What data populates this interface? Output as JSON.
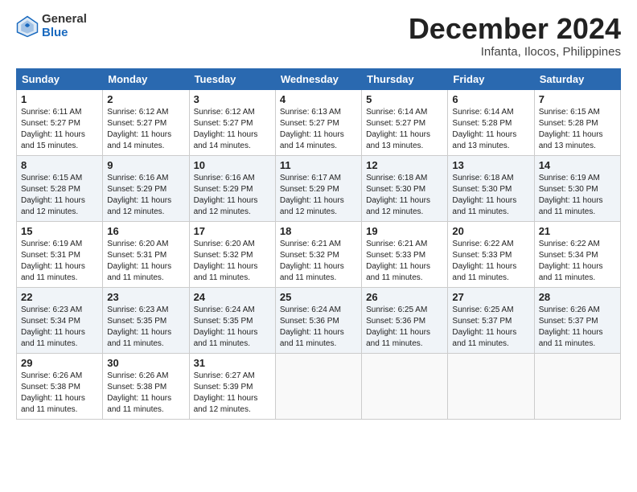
{
  "logo": {
    "general": "General",
    "blue": "Blue"
  },
  "header": {
    "month": "December 2024",
    "location": "Infanta, Ilocos, Philippines"
  },
  "weekdays": [
    "Sunday",
    "Monday",
    "Tuesday",
    "Wednesday",
    "Thursday",
    "Friday",
    "Saturday"
  ],
  "weeks": [
    [
      {
        "day": "1",
        "info": "Sunrise: 6:11 AM\nSunset: 5:27 PM\nDaylight: 11 hours\nand 15 minutes."
      },
      {
        "day": "2",
        "info": "Sunrise: 6:12 AM\nSunset: 5:27 PM\nDaylight: 11 hours\nand 14 minutes."
      },
      {
        "day": "3",
        "info": "Sunrise: 6:12 AM\nSunset: 5:27 PM\nDaylight: 11 hours\nand 14 minutes."
      },
      {
        "day": "4",
        "info": "Sunrise: 6:13 AM\nSunset: 5:27 PM\nDaylight: 11 hours\nand 14 minutes."
      },
      {
        "day": "5",
        "info": "Sunrise: 6:14 AM\nSunset: 5:27 PM\nDaylight: 11 hours\nand 13 minutes."
      },
      {
        "day": "6",
        "info": "Sunrise: 6:14 AM\nSunset: 5:28 PM\nDaylight: 11 hours\nand 13 minutes."
      },
      {
        "day": "7",
        "info": "Sunrise: 6:15 AM\nSunset: 5:28 PM\nDaylight: 11 hours\nand 13 minutes."
      }
    ],
    [
      {
        "day": "8",
        "info": "Sunrise: 6:15 AM\nSunset: 5:28 PM\nDaylight: 11 hours\nand 12 minutes."
      },
      {
        "day": "9",
        "info": "Sunrise: 6:16 AM\nSunset: 5:29 PM\nDaylight: 11 hours\nand 12 minutes."
      },
      {
        "day": "10",
        "info": "Sunrise: 6:16 AM\nSunset: 5:29 PM\nDaylight: 11 hours\nand 12 minutes."
      },
      {
        "day": "11",
        "info": "Sunrise: 6:17 AM\nSunset: 5:29 PM\nDaylight: 11 hours\nand 12 minutes."
      },
      {
        "day": "12",
        "info": "Sunrise: 6:18 AM\nSunset: 5:30 PM\nDaylight: 11 hours\nand 12 minutes."
      },
      {
        "day": "13",
        "info": "Sunrise: 6:18 AM\nSunset: 5:30 PM\nDaylight: 11 hours\nand 11 minutes."
      },
      {
        "day": "14",
        "info": "Sunrise: 6:19 AM\nSunset: 5:30 PM\nDaylight: 11 hours\nand 11 minutes."
      }
    ],
    [
      {
        "day": "15",
        "info": "Sunrise: 6:19 AM\nSunset: 5:31 PM\nDaylight: 11 hours\nand 11 minutes."
      },
      {
        "day": "16",
        "info": "Sunrise: 6:20 AM\nSunset: 5:31 PM\nDaylight: 11 hours\nand 11 minutes."
      },
      {
        "day": "17",
        "info": "Sunrise: 6:20 AM\nSunset: 5:32 PM\nDaylight: 11 hours\nand 11 minutes."
      },
      {
        "day": "18",
        "info": "Sunrise: 6:21 AM\nSunset: 5:32 PM\nDaylight: 11 hours\nand 11 minutes."
      },
      {
        "day": "19",
        "info": "Sunrise: 6:21 AM\nSunset: 5:33 PM\nDaylight: 11 hours\nand 11 minutes."
      },
      {
        "day": "20",
        "info": "Sunrise: 6:22 AM\nSunset: 5:33 PM\nDaylight: 11 hours\nand 11 minutes."
      },
      {
        "day": "21",
        "info": "Sunrise: 6:22 AM\nSunset: 5:34 PM\nDaylight: 11 hours\nand 11 minutes."
      }
    ],
    [
      {
        "day": "22",
        "info": "Sunrise: 6:23 AM\nSunset: 5:34 PM\nDaylight: 11 hours\nand 11 minutes."
      },
      {
        "day": "23",
        "info": "Sunrise: 6:23 AM\nSunset: 5:35 PM\nDaylight: 11 hours\nand 11 minutes."
      },
      {
        "day": "24",
        "info": "Sunrise: 6:24 AM\nSunset: 5:35 PM\nDaylight: 11 hours\nand 11 minutes."
      },
      {
        "day": "25",
        "info": "Sunrise: 6:24 AM\nSunset: 5:36 PM\nDaylight: 11 hours\nand 11 minutes."
      },
      {
        "day": "26",
        "info": "Sunrise: 6:25 AM\nSunset: 5:36 PM\nDaylight: 11 hours\nand 11 minutes."
      },
      {
        "day": "27",
        "info": "Sunrise: 6:25 AM\nSunset: 5:37 PM\nDaylight: 11 hours\nand 11 minutes."
      },
      {
        "day": "28",
        "info": "Sunrise: 6:26 AM\nSunset: 5:37 PM\nDaylight: 11 hours\nand 11 minutes."
      }
    ],
    [
      {
        "day": "29",
        "info": "Sunrise: 6:26 AM\nSunset: 5:38 PM\nDaylight: 11 hours\nand 11 minutes."
      },
      {
        "day": "30",
        "info": "Sunrise: 6:26 AM\nSunset: 5:38 PM\nDaylight: 11 hours\nand 11 minutes."
      },
      {
        "day": "31",
        "info": "Sunrise: 6:27 AM\nSunset: 5:39 PM\nDaylight: 11 hours\nand 12 minutes."
      },
      null,
      null,
      null,
      null
    ]
  ]
}
